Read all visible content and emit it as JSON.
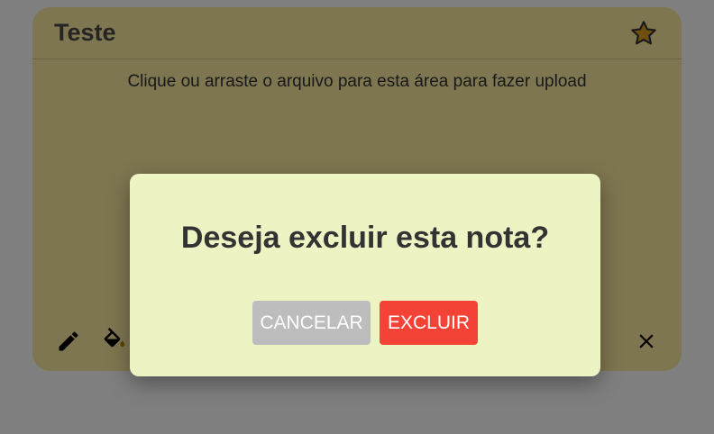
{
  "note": {
    "title": "Teste",
    "upload_text": "Clique ou arraste o arquivo para esta área para fazer upload",
    "icons": {
      "favorite": "star-icon",
      "edit": "pencil-icon",
      "color": "paint-bucket-icon",
      "close": "close-icon"
    }
  },
  "modal": {
    "title": "Deseja excluir esta nota?",
    "cancel_label": "CANCELAR",
    "delete_label": "EXCLUIR"
  },
  "colors": {
    "note_background": "#fdeca0",
    "modal_background": "#eef3c4",
    "cancel_button": "#bdbdbd",
    "delete_button": "#f44336",
    "star_fill": "#e0a020"
  }
}
